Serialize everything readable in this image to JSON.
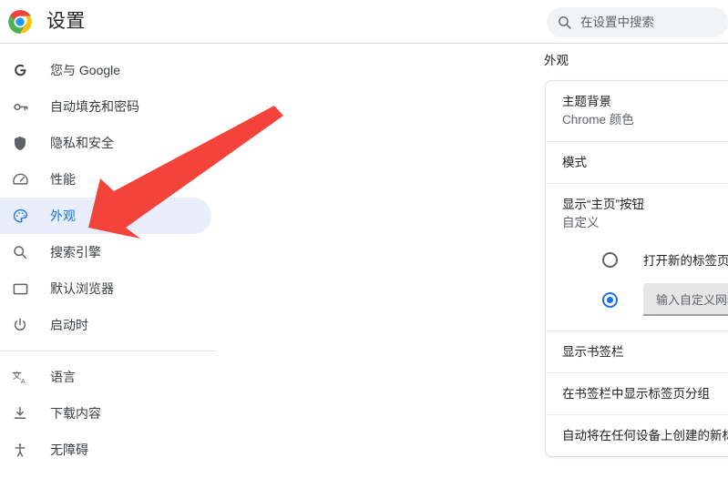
{
  "header": {
    "title": "设置",
    "logo_icon": "chrome-logo-icon"
  },
  "search": {
    "icon": "search-icon",
    "placeholder": "在设置中搜索",
    "value": ""
  },
  "sidebar": {
    "groups": [
      {
        "items": [
          {
            "label": "您与 Google",
            "icon": "google-g-icon",
            "selected": false
          },
          {
            "label": "自动填充和密码",
            "icon": "key-icon",
            "selected": false
          },
          {
            "label": "隐私和安全",
            "icon": "shield-icon",
            "selected": false
          },
          {
            "label": "性能",
            "icon": "speedometer-icon",
            "selected": false
          },
          {
            "label": "外观",
            "icon": "palette-icon",
            "selected": true
          },
          {
            "label": "搜索引擎",
            "icon": "search-icon",
            "selected": false
          },
          {
            "label": "默认浏览器",
            "icon": "window-icon",
            "selected": false
          },
          {
            "label": "启动时",
            "icon": "power-icon",
            "selected": false
          }
        ]
      },
      {
        "items": [
          {
            "label": "语言",
            "icon": "translate-icon",
            "selected": false
          },
          {
            "label": "下载内容",
            "icon": "download-icon",
            "selected": false
          },
          {
            "label": "无障碍",
            "icon": "accessibility-icon",
            "selected": false
          }
        ]
      }
    ]
  },
  "main": {
    "section_title": "外观",
    "rows": [
      {
        "type": "two-line",
        "title": "主题背景",
        "subtitle": "Chrome 颜色"
      },
      {
        "type": "one-line",
        "title": "模式",
        "subtitle": ""
      },
      {
        "type": "two-line",
        "title": "显示“主页”按钮",
        "subtitle": "自定义"
      }
    ],
    "home_button_options": [
      {
        "label": "打开新的标签页",
        "selected": false
      },
      {
        "label": "",
        "selected": true,
        "field_placeholder": "输入自定义网址",
        "field_value": ""
      }
    ],
    "bottom_rows": [
      {
        "title": "显示书签栏"
      },
      {
        "title": "在书签栏中显示标签页分组"
      },
      {
        "title": "自动将在任何设备上创建的新标"
      }
    ]
  },
  "annotation": {
    "arrow_color": "#f4433b",
    "arrow_name": "red-pointer-arrow",
    "points_to": "外观"
  }
}
